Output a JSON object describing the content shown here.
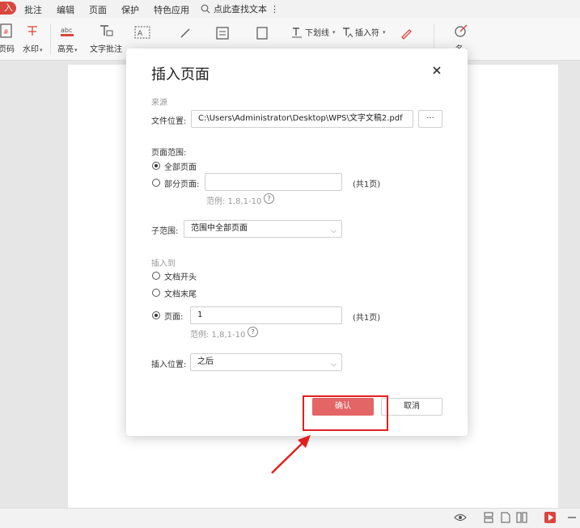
{
  "menu": {
    "active_tab": "入",
    "tabs": [
      "批注",
      "编辑",
      "页面",
      "保护",
      "特色应用"
    ],
    "search_text": "点此查找文本",
    "more": "⋮"
  },
  "toolbar": {
    "page_number": "页码",
    "watermark": "水印",
    "highlight": "高亮",
    "text_comment": "文字批注",
    "underline": "下划线",
    "insert_symbol": "插入符",
    "sign_partial": "名"
  },
  "dialog": {
    "title": "插入页面",
    "source_section": "来源",
    "file_location_label": "文件位置:",
    "file_path": "C:\\Users\\Administrator\\Desktop\\WPS\\文字文稿2.pdf",
    "browse": "···",
    "page_range_label": "页面范围:",
    "all_pages": "全部页面",
    "partial_pages": "部分页面:",
    "partial_value": "",
    "total_pages": "(共1页)",
    "example": "范例: 1,8,1-10",
    "help": "?",
    "subrange_label": "子范围:",
    "subrange_value": "范围中全部页面",
    "insert_to_section": "插入到",
    "doc_start": "文档开头",
    "doc_end": "文档末尾",
    "page_label": "页面:",
    "page_value": "1",
    "page_total": "(共1页)",
    "page_example": "范例: 1,8,1-10",
    "insert_position_label": "插入位置:",
    "insert_position_value": "之后",
    "confirm": "确认",
    "cancel": "取消"
  },
  "colors": {
    "accent": "#e46566",
    "highlight_box": "#e02020",
    "menu_active": "#d9463e"
  }
}
